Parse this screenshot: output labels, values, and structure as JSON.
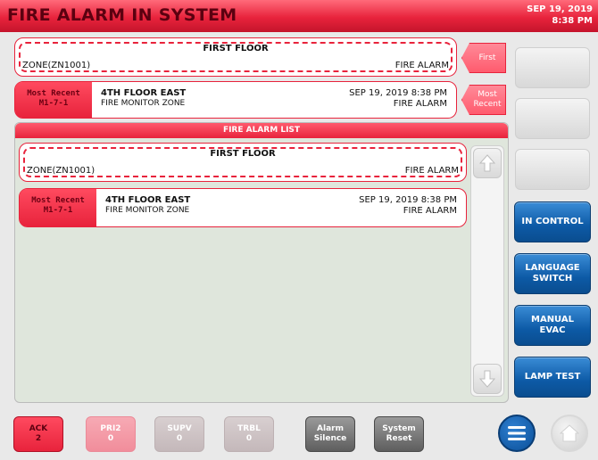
{
  "header": {
    "title": "FIRE ALARM IN SYSTEM",
    "date": "SEP 19, 2019",
    "time": "8:38 PM"
  },
  "top_cards": [
    {
      "heading": "FIRST FLOOR",
      "zone": "ZONE(ZN1001)",
      "status": "FIRE ALARM",
      "tag": "First"
    },
    {
      "badge_line1": "Most Recent",
      "badge_line2": "M1-7-1",
      "zone_name": "4TH FLOOR EAST",
      "zone_type": "FIRE MONITOR ZONE",
      "timestamp": "SEP 19, 2019 8:38 PM",
      "status": "FIRE ALARM",
      "tag_line1": "Most",
      "tag_line2": "Recent"
    }
  ],
  "list": {
    "title": "FIRE ALARM LIST",
    "items": [
      {
        "heading": "FIRST FLOOR",
        "zone": "ZONE(ZN1001)",
        "status": "FIRE ALARM"
      },
      {
        "badge_line1": "Most Recent",
        "badge_line2": "M1-7-1",
        "zone_name": "4TH FLOOR EAST",
        "zone_type": "FIRE MONITOR ZONE",
        "timestamp": "SEP 19, 2019 8:38 PM",
        "status": "FIRE ALARM"
      }
    ]
  },
  "side_buttons": {
    "in_control": "IN CONTROL",
    "language_line1": "LANGUAGE",
    "language_line2": "SWITCH",
    "manual_line1": "MANUAL",
    "manual_line2": "EVAC",
    "lamp_test": "LAMP TEST"
  },
  "bottom_buttons": [
    {
      "label": "ACK",
      "count": "2"
    },
    {
      "label": "PRI2",
      "count": "0"
    },
    {
      "label": "SUPV",
      "count": "0"
    },
    {
      "label": "TRBL",
      "count": "0"
    },
    {
      "label_line1": "Alarm",
      "label_line2": "Silence"
    },
    {
      "label_line1": "System",
      "label_line2": "Reset"
    }
  ],
  "icons": {
    "menu": "menu-icon",
    "home": "home-icon",
    "scroll_up": "arrow-up-icon",
    "scroll_down": "arrow-down-icon"
  },
  "colors": {
    "alarm_red": "#e8233c",
    "control_blue": "#0d5aa6"
  }
}
